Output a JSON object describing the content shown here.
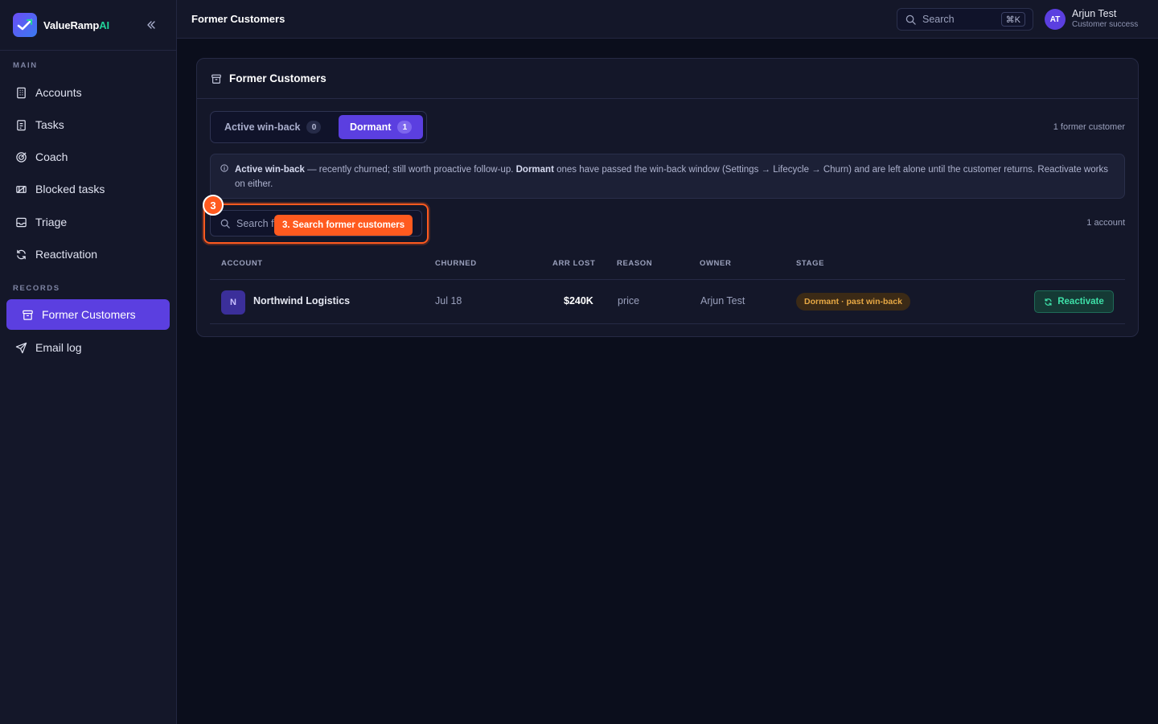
{
  "brand": {
    "name": "ValueRamp",
    "name_suffix": "AI"
  },
  "sidebar": {
    "section_main": "MAIN",
    "section_records": "RECORDS",
    "items": [
      {
        "label": "Accounts",
        "icon": "building-icon"
      },
      {
        "label": "Tasks",
        "icon": "clipboard-icon"
      },
      {
        "label": "Coach",
        "icon": "target-icon"
      },
      {
        "label": "Blocked tasks",
        "icon": "blocked-icon"
      },
      {
        "label": "Triage",
        "icon": "inbox-icon"
      },
      {
        "label": "Reactivation",
        "icon": "refresh-icon"
      },
      {
        "label": "Former Customers",
        "icon": "archive-icon",
        "active": true
      },
      {
        "label": "Email log",
        "icon": "send-icon"
      }
    ]
  },
  "header": {
    "title": "Former Customers",
    "search_placeholder": "Search",
    "search_shortcut": "⌘K",
    "user": {
      "initials": "AT",
      "name": "Arjun Test",
      "role": "Customer success"
    }
  },
  "main": {
    "card_title": "Former Customers",
    "tabs": [
      {
        "label": "Active win-back",
        "count": "0",
        "active": false
      },
      {
        "label": "Dormant",
        "count": "1",
        "active": true
      }
    ],
    "former_count": "1 former customer",
    "info": {
      "term1": "Active win-back",
      "text1": " — recently churned; still worth proactive follow-up. ",
      "term2": "Dormant",
      "text2": " ones have passed the win-back window (Settings → Lifecycle → Churn) and are left alone until the customer returns. Reactivate works on either."
    },
    "search_placeholder": "Search former customers",
    "search_visible": "Search f",
    "callout": "3. Search former customers",
    "step_number": "3",
    "account_count": "1 account",
    "columns": [
      "ACCOUNT",
      "CHURNED",
      "ARR LOST",
      "REASON",
      "OWNER",
      "STAGE"
    ],
    "rows": [
      {
        "initial": "N",
        "account": "Northwind Logistics",
        "churned": "Jul 18",
        "arr_lost": "$240K",
        "reason": "price",
        "owner": "Arjun Test",
        "stage": "Dormant · past win-back",
        "action": "Reactivate"
      }
    ]
  },
  "colors": {
    "accent": "#5b3fe0",
    "highlight": "#ff5a1f",
    "success": "#3ee0a8",
    "warning": "#e7a844"
  }
}
